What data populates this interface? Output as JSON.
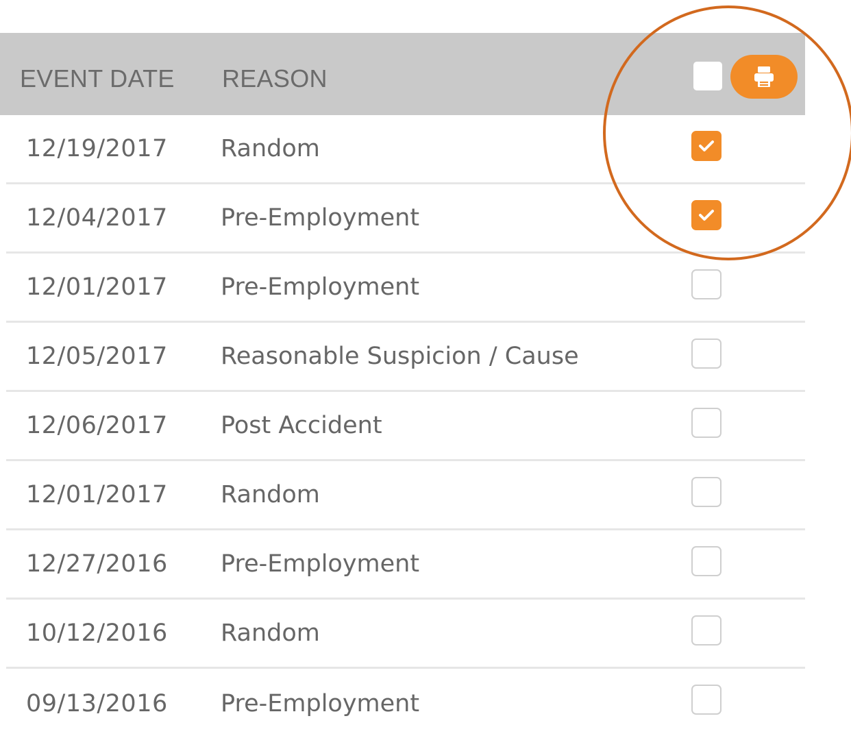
{
  "table": {
    "columns": {
      "event_date": "EVENT DATE",
      "reason": "REASON"
    },
    "select_all_checked": false,
    "print_icon": "printer-icon",
    "rows": [
      {
        "date": "12/19/2017",
        "reason": "Random",
        "checked": true
      },
      {
        "date": "12/04/2017",
        "reason": "Pre-Employment",
        "checked": true
      },
      {
        "date": "12/01/2017",
        "reason": "Pre-Employment",
        "checked": false
      },
      {
        "date": "12/05/2017",
        "reason": "Reasonable Suspicion / Cause",
        "checked": false
      },
      {
        "date": "12/06/2017",
        "reason": "Post Accident",
        "checked": false
      },
      {
        "date": "12/01/2017",
        "reason": "Random",
        "checked": false
      },
      {
        "date": "12/27/2016",
        "reason": "Pre-Employment",
        "checked": false
      },
      {
        "date": "10/12/2016",
        "reason": "Random",
        "checked": false
      },
      {
        "date": "09/13/2016",
        "reason": "Pre-Employment",
        "checked": false
      }
    ]
  },
  "colors": {
    "accent": "#f28c28",
    "header_bg": "#c9c9c9",
    "annotation": "#d2691e"
  }
}
